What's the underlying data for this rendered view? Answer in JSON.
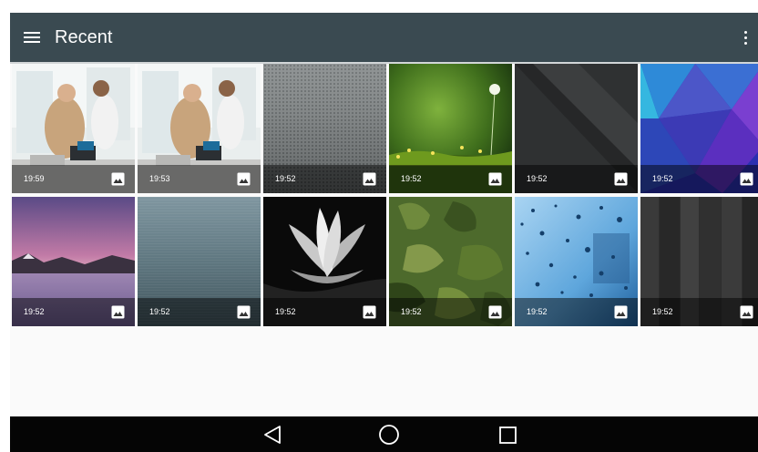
{
  "app_bar": {
    "title": "Recent",
    "background": "#3a4a51",
    "menu_icon": "hamburger-menu-icon",
    "overflow_icon": "more-vertical-icon"
  },
  "photos": [
    {
      "time": "19:59",
      "thumbnail": "office meeting with desk phone"
    },
    {
      "time": "19:53",
      "thumbnail": "office meeting with desk phone"
    },
    {
      "time": "19:52",
      "thumbnail": "grey metal mesh texture"
    },
    {
      "time": "19:52",
      "thumbnail": "green meadow with dandelion"
    },
    {
      "time": "19:52",
      "thumbnail": "dark diagonal texture"
    },
    {
      "time": "19:52",
      "thumbnail": "blue purple polygon abstract"
    },
    {
      "time": "19:52",
      "thumbnail": "purple sky lake with mountains"
    },
    {
      "time": "19:52",
      "thumbnail": "brushed blue-grey metal"
    },
    {
      "time": "19:52",
      "thumbnail": "white lotus flower on black"
    },
    {
      "time": "19:52",
      "thumbnail": "green camouflage pattern"
    },
    {
      "time": "19:52",
      "thumbnail": "water drops on blue glass"
    },
    {
      "time": "19:52",
      "thumbnail": "dark wood planks"
    }
  ],
  "nav_bar": {
    "back_icon": "back-triangle-icon",
    "home_icon": "home-circle-icon",
    "recents_icon": "recents-square-icon"
  }
}
